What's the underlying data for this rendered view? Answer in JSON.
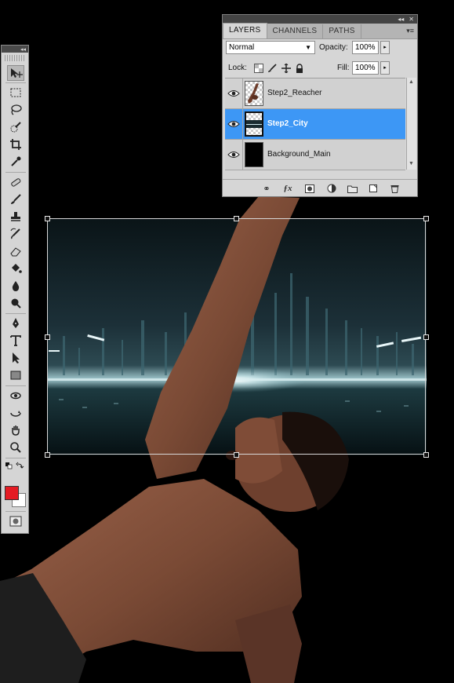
{
  "panel": {
    "tabs": [
      {
        "label": "LAYERS"
      },
      {
        "label": "CHANNELS"
      },
      {
        "label": "PATHS"
      }
    ],
    "blend_mode": "Normal",
    "opacity_label": "Opacity:",
    "opacity_value": "100%",
    "lock_label": "Lock:",
    "fill_label": "Fill:",
    "fill_value": "100%",
    "layers": [
      {
        "name": "Step2_Reacher",
        "visible": true,
        "selected": false
      },
      {
        "name": "Step2_City",
        "visible": true,
        "selected": true
      },
      {
        "name": "Background_Main",
        "visible": true,
        "selected": false
      }
    ],
    "bottom_icons": [
      "link-icon",
      "fx-icon",
      "mask-icon",
      "adjustment-icon",
      "folder-icon",
      "new-layer-icon",
      "trash-icon"
    ]
  },
  "toolbar": {
    "tools": [
      "move-tool",
      "marquee-tool",
      "lasso-tool",
      "quick-select-tool",
      "crop-tool",
      "eyedropper-tool",
      "healing-tool",
      "brush-tool",
      "stamp-tool",
      "history-brush-tool",
      "eraser-tool",
      "bucket-tool",
      "blur-tool",
      "dodge-tool",
      "pen-tool",
      "type-tool",
      "path-select-tool",
      "shape-tool",
      "3d-rotate-tool",
      "3d-orbit-tool",
      "hand-tool",
      "zoom-tool"
    ],
    "active_tool": "move-tool",
    "foreground_color": "#e41b23",
    "background_color": "#ffffff"
  },
  "colors": {
    "selection_highlight": "#3d97f5",
    "canvas_background": "#000000"
  }
}
